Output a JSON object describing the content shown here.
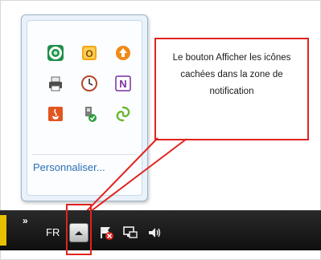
{
  "popup": {
    "icons": [
      "green-ring-icon",
      "office-o-icon",
      "orange-update-icon",
      "printer-icon",
      "clock-icon",
      "onenote-icon",
      "java-icon",
      "safely-remove-hardware-icon",
      "green-swirl-icon"
    ],
    "customize_label": "Personnaliser..."
  },
  "taskbar": {
    "chevron": "»",
    "language": "FR",
    "system_icons": [
      "network-error-icon",
      "network-icon",
      "volume-icon"
    ]
  },
  "callout": {
    "text": "Le bouton Afficher les icônes cachées dans la zone de notification"
  },
  "colors": {
    "callout_border": "#e1231f",
    "link": "#2a6fb5",
    "taskbar": "#1a1a1a"
  }
}
